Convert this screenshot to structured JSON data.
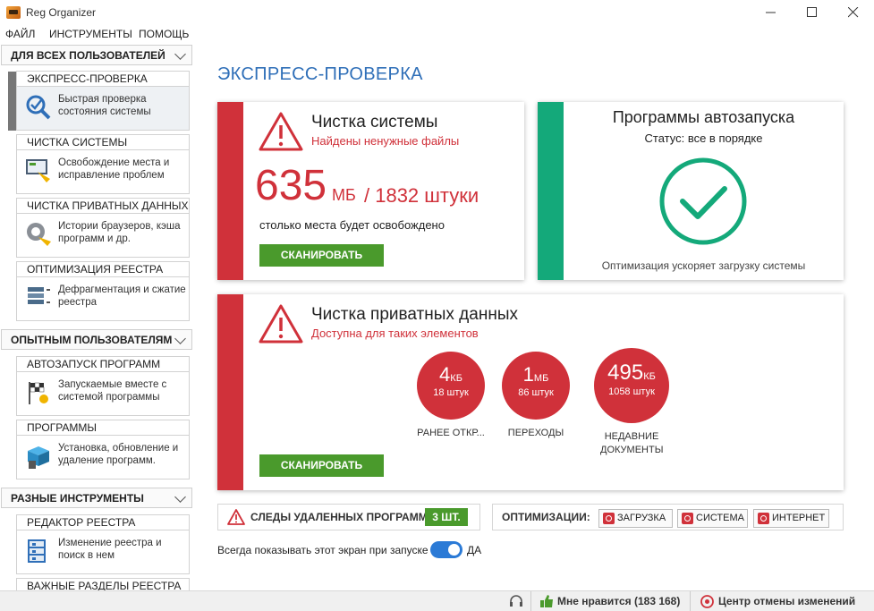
{
  "window": {
    "title": "Reg Organizer"
  },
  "menu": [
    "ФАЙЛ",
    "ИНСТРУМЕНТЫ",
    "ПОМОЩЬ"
  ],
  "sidebar": {
    "sections": [
      {
        "label": "ДЛЯ ВСЕХ ПОЛЬЗОВАТЕЛЕЙ"
      },
      {
        "label": "ОПЫТНЫМ ПОЛЬЗОВАТЕЛЯМ"
      },
      {
        "label": "РАЗНЫЕ ИНСТРУМЕНТЫ"
      }
    ],
    "items": [
      {
        "title": "ЭКСПРЕСС-ПРОВЕРКА",
        "desc": "Быстрая проверка состояния системы",
        "icon": "check-magnifier-icon"
      },
      {
        "title": "ЧИСТКА СИСТЕМЫ",
        "desc": "Освобождение места и исправление проблем",
        "icon": "broom-screen-icon"
      },
      {
        "title": "ЧИСТКА ПРИВАТНЫХ ДАННЫХ",
        "desc": "Истории браузеров, кэша программ и др.",
        "icon": "privacy-clean-icon"
      },
      {
        "title": "ОПТИМИЗАЦИЯ РЕЕСТРА",
        "desc": "Дефрагментация и сжатие реестра",
        "icon": "registry-optimize-icon"
      },
      {
        "title": "АВТОЗАПУСК ПРОГРАММ",
        "desc": "Запускаемые вместе с системой программы",
        "icon": "autostart-flag-icon"
      },
      {
        "title": "ПРОГРАММЫ",
        "desc": "Установка, обновление и удаление программ.",
        "icon": "programs-box-icon"
      },
      {
        "title": "РЕДАКТОР РЕЕСТРА",
        "desc": "Изменение реестра и поиск в нем",
        "icon": "registry-editor-icon"
      },
      {
        "title": "ВАЖНЫЕ РАЗДЕЛЫ РЕЕСТРА",
        "desc": "",
        "icon": ""
      }
    ]
  },
  "main": {
    "title": "ЭКСПРЕСС-ПРОВЕРКА",
    "system_clean": {
      "title": "Чистка системы",
      "subtitle": "Найдены ненужные файлы",
      "size": "635",
      "size_unit": "МБ",
      "files": "/ 1832 штуки",
      "note": "столько места будет освобождено",
      "button": "СКАНИРОВАТЬ"
    },
    "autostart": {
      "title": "Программы автозапуска",
      "status": "Статус: все в порядке",
      "note": "Оптимизация ускоряет загрузку системы"
    },
    "private": {
      "title": "Чистка приватных данных",
      "subtitle": "Доступна для таких элементов",
      "button": "СКАНИРОВАТЬ",
      "items": [
        {
          "value": "4",
          "unit": "КБ",
          "count": "18 штук",
          "label": "РАНЕЕ ОТКР..."
        },
        {
          "value": "1",
          "unit": "МБ",
          "count": "86 штук",
          "label": "ПЕРЕХОДЫ"
        },
        {
          "value": "495",
          "unit": "КБ",
          "count": "1058 штук",
          "label": "НЕДАВНИЕ ДОКУМЕНТЫ"
        }
      ]
    },
    "traces": {
      "label": "СЛЕДЫ УДАЛЕННЫХ ПРОГРАММ",
      "count": "3 ШТ."
    },
    "optimizations": {
      "label": "ОПТИМИЗАЦИИ:",
      "buttons": [
        "ЗАГРУЗКА",
        "СИСТЕМА",
        "ИНТЕРНЕТ"
      ]
    },
    "show_on_start": {
      "label": "Всегда показывать этот экран при запуске",
      "value": "ДА"
    }
  },
  "statusbar": {
    "like": "Мне нравится (183 168)",
    "undo": "Центр отмены изменений"
  },
  "colors": {
    "accent_red": "#d0313a",
    "accent_green": "#14a97a",
    "button_green": "#4a9a2c",
    "title_blue": "#2f6fb8"
  }
}
